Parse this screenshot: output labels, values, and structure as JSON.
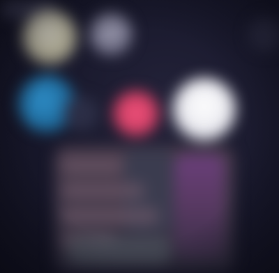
{
  "screen": {
    "background_color": "#141422"
  },
  "apps": [
    {
      "name": "app-icon-yellow",
      "color": "#b7b39c"
    },
    {
      "name": "app-icon-grey",
      "color": "#6e6d84"
    },
    {
      "name": "app-icon-dark",
      "color": "#2a2a40"
    },
    {
      "name": "app-icon-blue",
      "color": "#1f6c9e"
    },
    {
      "name": "app-icon-dark-small",
      "color": "#2c2e46"
    },
    {
      "name": "app-icon-pink",
      "color": "#d13f66"
    },
    {
      "name": "app-icon-white",
      "color": "#e9e9ef"
    }
  ],
  "panel": {
    "color": "#3d3545",
    "accent_color": "#5a3a64"
  }
}
